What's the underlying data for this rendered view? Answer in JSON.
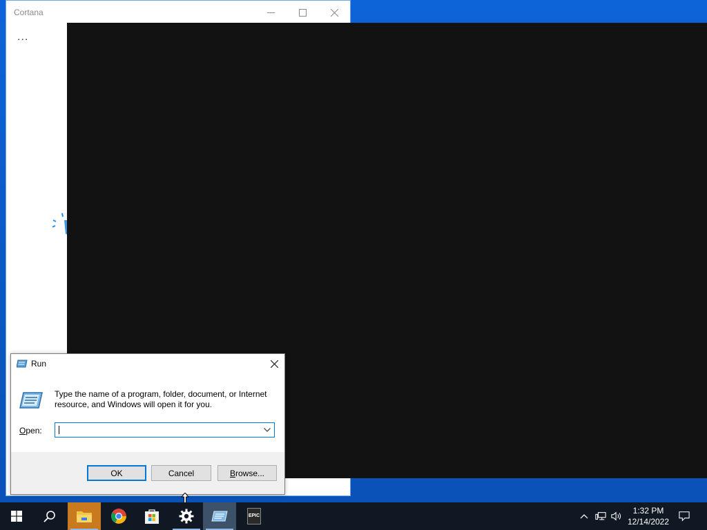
{
  "cortana": {
    "title": "Cortana",
    "more_label": "..."
  },
  "run_dialog": {
    "title": "Run",
    "description": "Type the name of a program, folder, document, or Internet resource, and Windows will open it for you.",
    "open_label_accel": "O",
    "open_label_rest": "pen:",
    "input_value": "",
    "ok_label": "OK",
    "cancel_label": "Cancel",
    "browse_label_accel": "B",
    "browse_label_rest": "rowse..."
  },
  "taskbar": {
    "items": [
      {
        "name": "start",
        "icon": "windows-logo-icon"
      },
      {
        "name": "search",
        "icon": "search-icon"
      },
      {
        "name": "file-explorer",
        "icon": "folder-icon"
      },
      {
        "name": "chrome",
        "icon": "chrome-icon"
      },
      {
        "name": "store",
        "icon": "store-icon"
      },
      {
        "name": "settings",
        "icon": "gear-icon"
      },
      {
        "name": "run",
        "icon": "run-icon"
      },
      {
        "name": "epic-games",
        "icon": "epic-games-icon",
        "label": "EPIC"
      }
    ],
    "clock_time": "1:32 PM",
    "clock_date": "12/14/2022"
  },
  "colors": {
    "accent": "#0078d7",
    "taskbar": "#101824",
    "overlay": "#121212"
  }
}
